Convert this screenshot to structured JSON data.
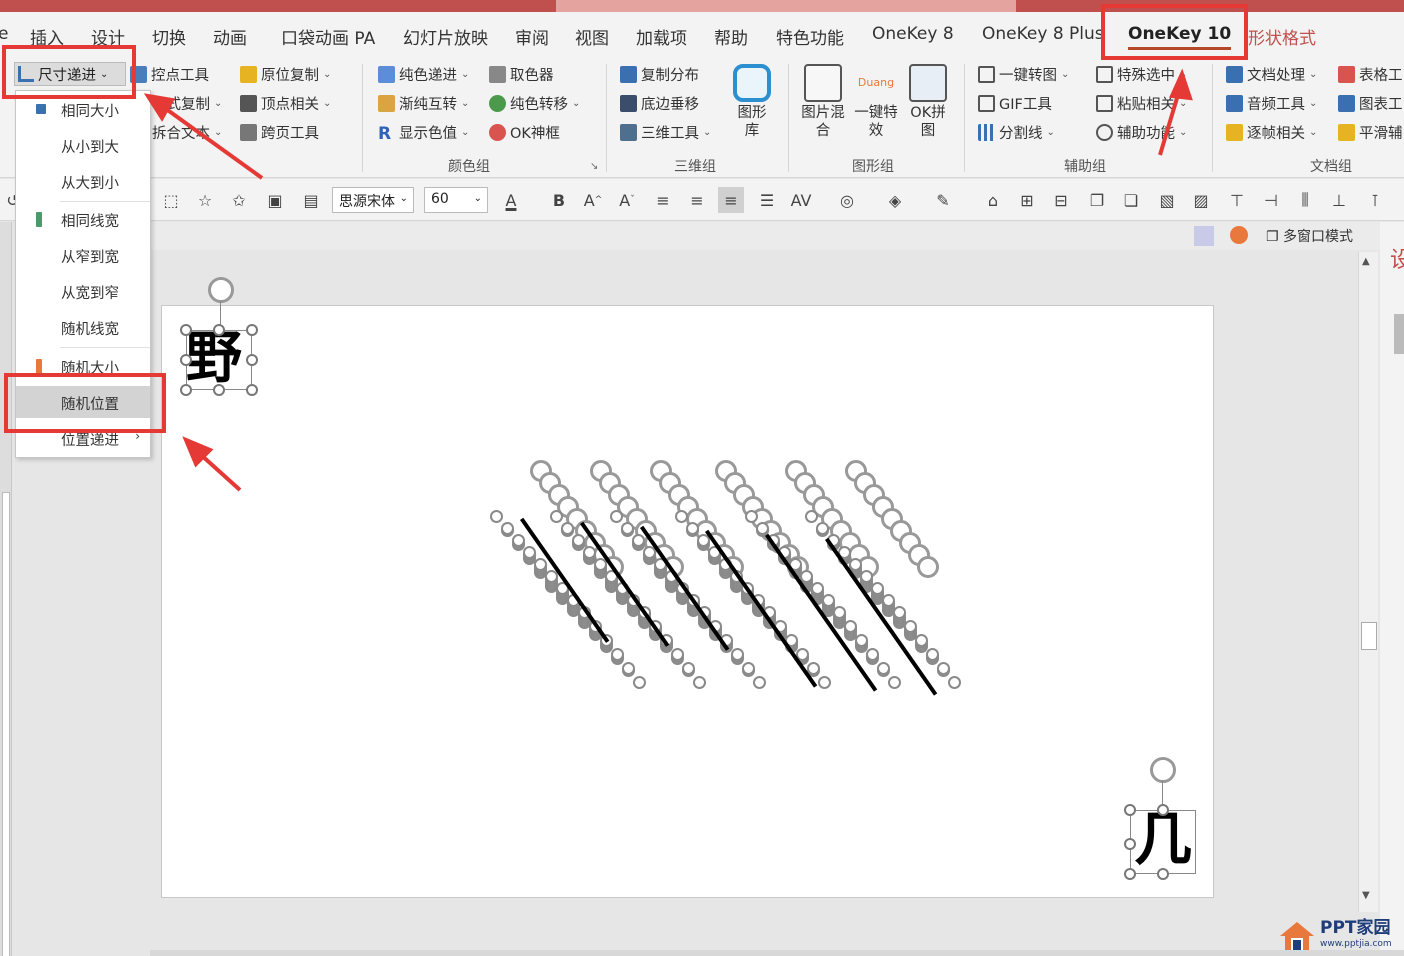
{
  "tabs": [
    "e",
    "插入",
    "设计",
    "切换",
    "动画",
    "口袋动画 PA",
    "幻灯片放映",
    "审阅",
    "视图",
    "加载项",
    "帮助",
    "特色功能",
    "OneKey 8",
    "OneKey 8 Plus",
    "OneKey 10",
    "形状格式"
  ],
  "active_tab": "OneKey 10",
  "ribbon": {
    "size_progression": "尺寸递进",
    "buttons": {
      "control_point": "控点工具",
      "copy_original": "原位复制",
      "pattern_copy": "格式复制",
      "vertex_related": "顶点相关",
      "split_text": "拆合文本",
      "cross_page": "跨页工具",
      "solid_color_progression": "纯色递进",
      "color_picker": "取色器",
      "gradient_solid_swap": "渐纯互转",
      "solid_color_transfer": "纯色转移",
      "show_color_value": "显示色值",
      "ok_frame": "OK神框",
      "copy_distribute": "复制分布",
      "bottom_vertical": "底边垂移",
      "three_d_tools": "三维工具",
      "shape_library": "图形库",
      "image_mix": "图片混合",
      "one_key_effect": "一键特效",
      "ok_puzzle": "OK拼图",
      "one_key_convert": "一键转图",
      "special_select": "特殊选中",
      "gif_tool": "GIF工具",
      "paste_related": "粘贴相关",
      "split_line": "分割线",
      "assist_function": "辅助功能",
      "doc_process": "文档处理",
      "table_tool": "表格工",
      "audio_tool": "音频工具",
      "chart_tool": "图表工",
      "frame_related": "逐帧相关",
      "smooth": "平滑辅"
    },
    "duang": "Duang",
    "groups": [
      "颜色组",
      "三维组",
      "图形组",
      "辅助组",
      "文档组"
    ]
  },
  "format_bar": {
    "font_name": "思源宋体",
    "font_size": "60",
    "bold": "B"
  },
  "view_bar": {
    "multi_window": "多窗口模式"
  },
  "menu": {
    "items": [
      "相同大小",
      "从小到大",
      "从大到小",
      "相同线宽",
      "从窄到宽",
      "从宽到窄",
      "随机线宽",
      "随机大小",
      "随机位置",
      "位置递进"
    ],
    "highlighted": "随机位置"
  },
  "slide": {
    "glyph_left": "野",
    "glyph_right": "几"
  },
  "watermark": {
    "brand": "PPT家园",
    "url": "www.pptjia.com"
  },
  "colors": {
    "accent_red": "#e53935",
    "title_bar": "#c0504d",
    "context_tab": "#c0504d",
    "menu_highlight": "#d3d3d3"
  }
}
